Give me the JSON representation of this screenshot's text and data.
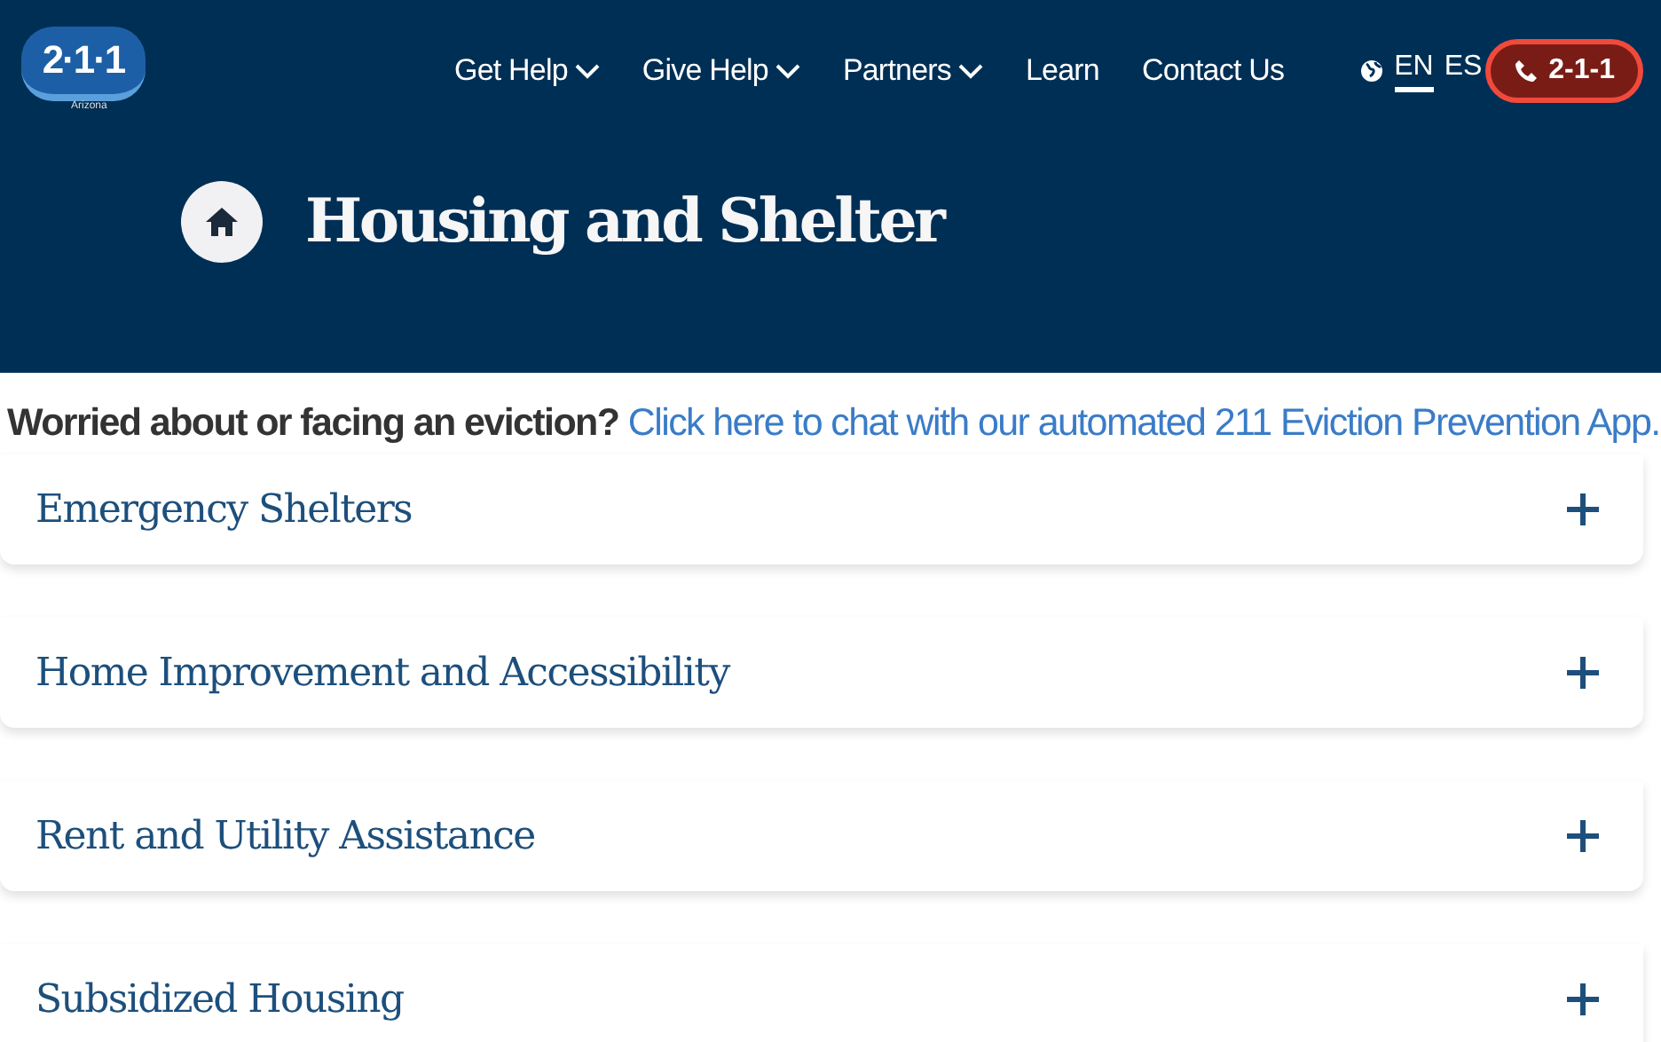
{
  "logo": {
    "text": "2·1·1",
    "subtext": "Arizona"
  },
  "nav": [
    {
      "label": "Get Help",
      "has_menu": true
    },
    {
      "label": "Give Help",
      "has_menu": true
    },
    {
      "label": "Partners",
      "has_menu": true
    },
    {
      "label": "Learn",
      "has_menu": false
    },
    {
      "label": "Contact Us",
      "has_menu": false
    }
  ],
  "languages": [
    {
      "label": "EN",
      "selected": true
    },
    {
      "label": "ES",
      "selected": false
    }
  ],
  "call_button": {
    "label": "2-1-1"
  },
  "page_title": "Housing and Shelter",
  "notice": {
    "lead": "Worried about or facing an eviction?",
    "link": "Click here to chat with our automated 211 Eviction Prevention App."
  },
  "sections": [
    {
      "label": "Emergency Shelters",
      "expanded": false
    },
    {
      "label": "Home Improvement and Accessibility",
      "expanded": false
    },
    {
      "label": "Rent and Utility Assistance",
      "expanded": false
    },
    {
      "label": "Subsidized Housing",
      "expanded": false
    }
  ]
}
